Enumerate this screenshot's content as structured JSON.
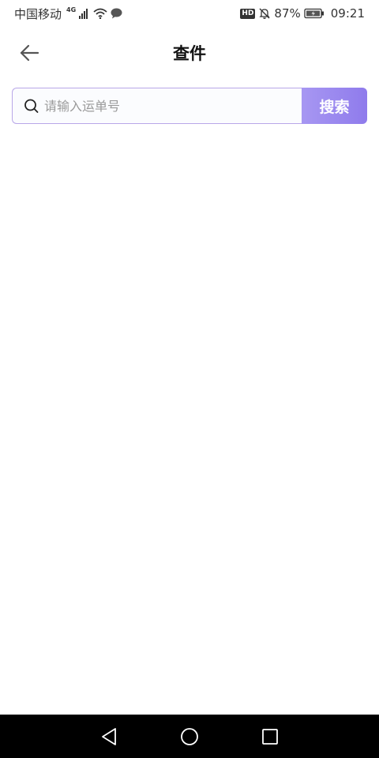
{
  "status_bar": {
    "carrier": "中国移动",
    "network": "4G",
    "hd": "HD",
    "battery_percent": "87%",
    "time": "09:21",
    "icons": [
      "signal-icon",
      "wifi-icon",
      "message-icon",
      "mute-bell-icon",
      "battery-charging-icon"
    ]
  },
  "header": {
    "title": "查件",
    "back_icon": "arrow-left-icon"
  },
  "search": {
    "placeholder": "请输入运单号",
    "value": "",
    "button_label": "搜索",
    "icon": "search-icon"
  },
  "nav_bar": {
    "icons": [
      "nav-back-icon",
      "nav-home-icon",
      "nav-recent-icon"
    ]
  },
  "colors": {
    "accent": "#8f7bec",
    "accent_light": "#a797f2",
    "search_border": "#b9a7e8",
    "nav_bg": "#000000"
  }
}
